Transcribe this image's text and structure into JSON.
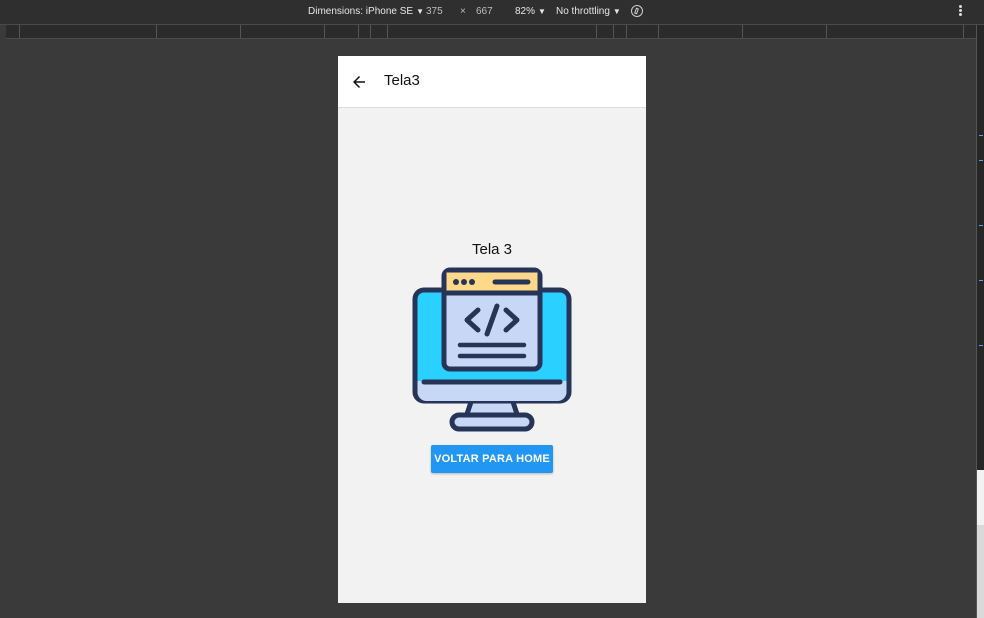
{
  "devtools": {
    "dimensions_label": "Dimensions: iPhone SE",
    "width": "375",
    "times": "×",
    "height": "667",
    "zoom": "82%",
    "throttling": "No throttling",
    "caret": "▼"
  },
  "app": {
    "title": "Tela3",
    "screen_text": "Tela 3",
    "button_label": "VOLTAR PARA HOME",
    "back_icon": "arrow-left-icon",
    "illustration_icon": "monitor-code-icon"
  },
  "colors": {
    "accent": "#2196f3",
    "monitor_screen": "#2ad0ff",
    "window_header": "#ffd88a",
    "window_body": "#c7d8f6",
    "outline": "#263458"
  }
}
